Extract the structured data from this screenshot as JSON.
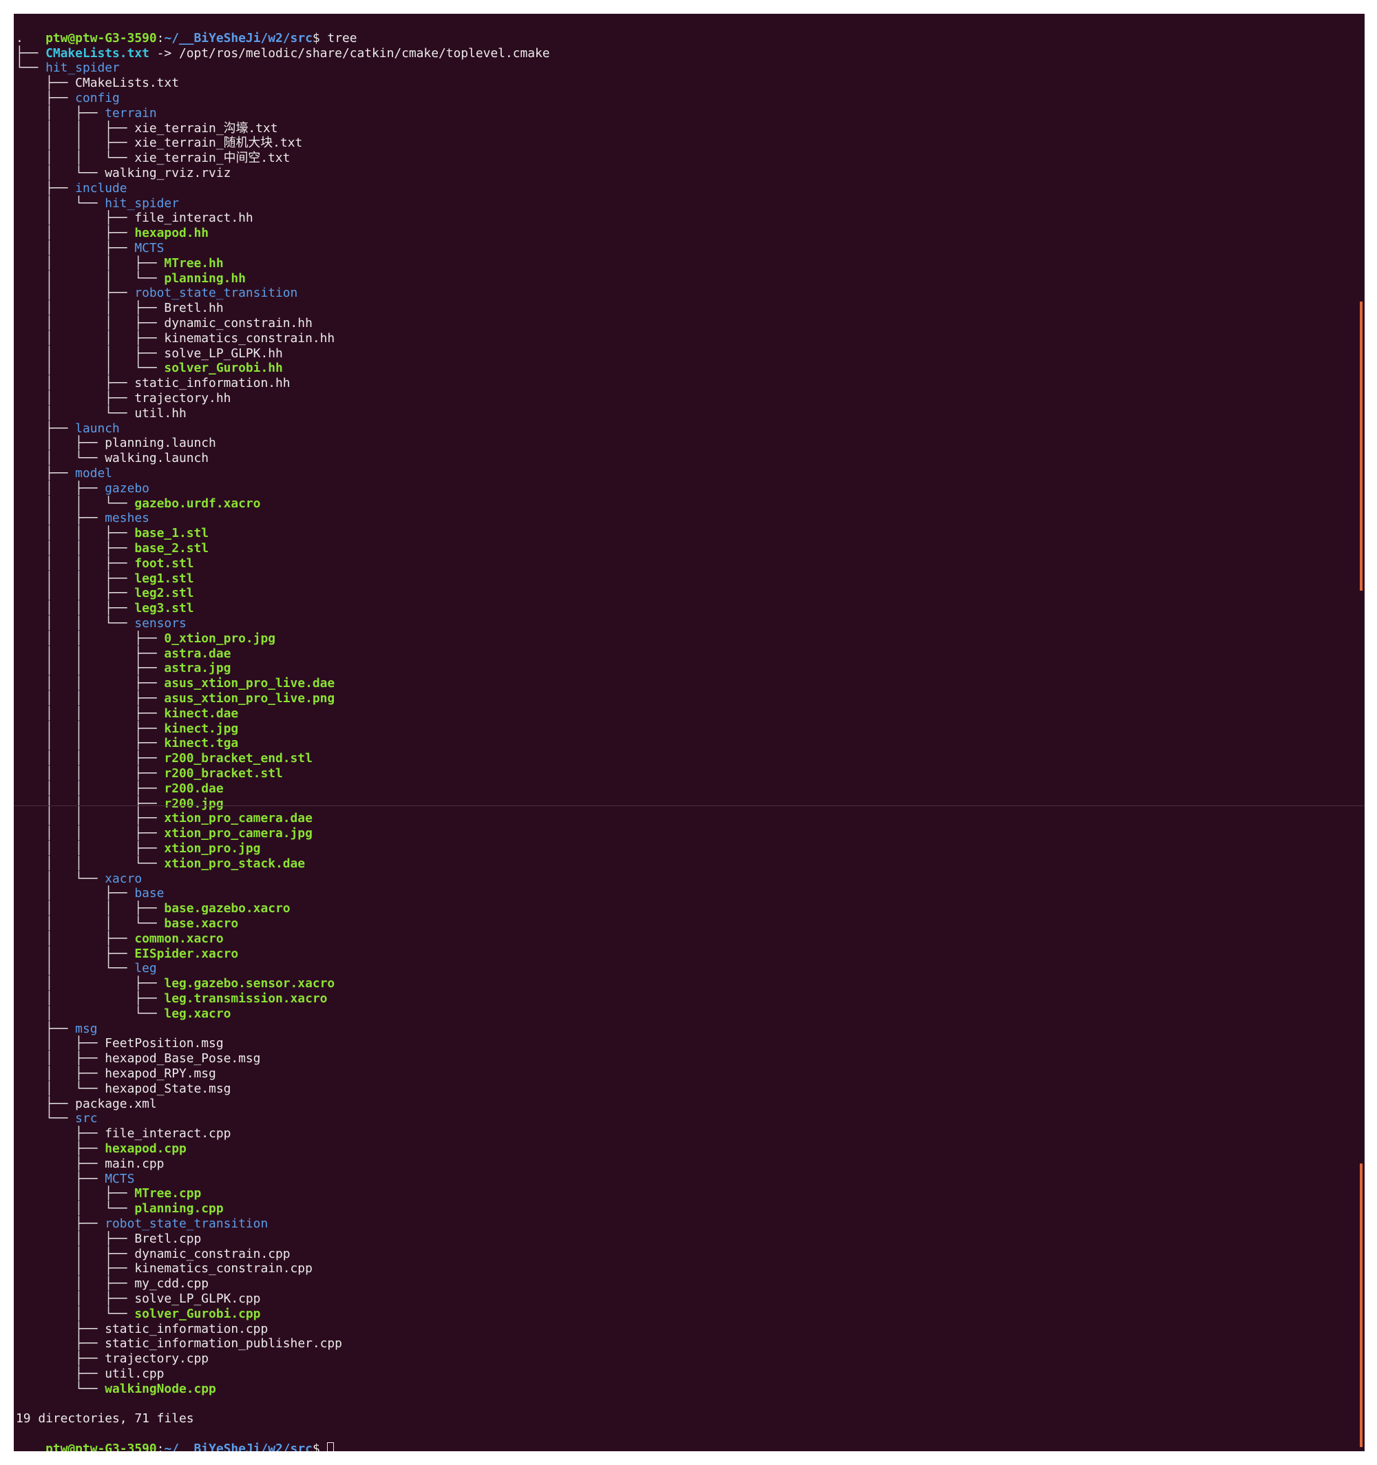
{
  "colors": {
    "terminal_background": "#2b0c1e",
    "text": "#ecebeb",
    "directory": "#5a9dea",
    "executable": "#8ae234",
    "symlink": "#38c6e0",
    "scroll_marker": "#e06a3c"
  },
  "prompt": {
    "user_host": "ptw@ptw-G3-3590",
    "separator": ":",
    "path": "~/__BiYeSheJi/w2/src",
    "symbol": "$ ",
    "command": "tree"
  },
  "tree": [
    {
      "prefix": "",
      "name": ".",
      "kind": "dir_plain"
    },
    {
      "prefix": "├── ",
      "name": "CMakeLists.txt",
      "kind": "link",
      "target": " -> /opt/ros/melodic/share/catkin/cmake/toplevel.cmake"
    },
    {
      "prefix": "└── ",
      "name": "hit_spider",
      "kind": "dir"
    },
    {
      "prefix": "    ├── ",
      "name": "CMakeLists.txt",
      "kind": "file"
    },
    {
      "prefix": "    ├── ",
      "name": "config",
      "kind": "dir"
    },
    {
      "prefix": "    │   ├── ",
      "name": "terrain",
      "kind": "dir"
    },
    {
      "prefix": "    │   │   ├── ",
      "name": "xie_terrain_沟壕.txt",
      "kind": "file"
    },
    {
      "prefix": "    │   │   ├── ",
      "name": "xie_terrain_随机大块.txt",
      "kind": "file"
    },
    {
      "prefix": "    │   │   └── ",
      "name": "xie_terrain_中间空.txt",
      "kind": "file"
    },
    {
      "prefix": "    │   └── ",
      "name": "walking_rviz.rviz",
      "kind": "file"
    },
    {
      "prefix": "    ├── ",
      "name": "include",
      "kind": "dir"
    },
    {
      "prefix": "    │   └── ",
      "name": "hit_spider",
      "kind": "dir"
    },
    {
      "prefix": "    │       ├── ",
      "name": "file_interact.hh",
      "kind": "file"
    },
    {
      "prefix": "    │       ├── ",
      "name": "hexapod.hh",
      "kind": "exec"
    },
    {
      "prefix": "    │       ├── ",
      "name": "MCTS",
      "kind": "dir"
    },
    {
      "prefix": "    │       │   ├── ",
      "name": "MTree.hh",
      "kind": "exec"
    },
    {
      "prefix": "    │       │   └── ",
      "name": "planning.hh",
      "kind": "exec"
    },
    {
      "prefix": "    │       ├── ",
      "name": "robot_state_transition",
      "kind": "dir"
    },
    {
      "prefix": "    │       │   ├── ",
      "name": "Bretl.hh",
      "kind": "file"
    },
    {
      "prefix": "    │       │   ├── ",
      "name": "dynamic_constrain.hh",
      "kind": "file"
    },
    {
      "prefix": "    │       │   ├── ",
      "name": "kinematics_constrain.hh",
      "kind": "file"
    },
    {
      "prefix": "    │       │   ├── ",
      "name": "solve_LP_GLPK.hh",
      "kind": "file"
    },
    {
      "prefix": "    │       │   └── ",
      "name": "solver_Gurobi.hh",
      "kind": "exec"
    },
    {
      "prefix": "    │       ├── ",
      "name": "static_information.hh",
      "kind": "file"
    },
    {
      "prefix": "    │       ├── ",
      "name": "trajectory.hh",
      "kind": "file"
    },
    {
      "prefix": "    │       └── ",
      "name": "util.hh",
      "kind": "file"
    },
    {
      "prefix": "    ├── ",
      "name": "launch",
      "kind": "dir"
    },
    {
      "prefix": "    │   ├── ",
      "name": "planning.launch",
      "kind": "file"
    },
    {
      "prefix": "    │   └── ",
      "name": "walking.launch",
      "kind": "file"
    },
    {
      "prefix": "    ├── ",
      "name": "model",
      "kind": "dir"
    },
    {
      "prefix": "    │   ├── ",
      "name": "gazebo",
      "kind": "dir"
    },
    {
      "prefix": "    │   │   └── ",
      "name": "gazebo.urdf.xacro",
      "kind": "exec"
    },
    {
      "prefix": "    │   ├── ",
      "name": "meshes",
      "kind": "dir"
    },
    {
      "prefix": "    │   │   ├── ",
      "name": "base_1.stl",
      "kind": "exec"
    },
    {
      "prefix": "    │   │   ├── ",
      "name": "base_2.stl",
      "kind": "exec"
    },
    {
      "prefix": "    │   │   ├── ",
      "name": "foot.stl",
      "kind": "exec"
    },
    {
      "prefix": "    │   │   ├── ",
      "name": "leg1.stl",
      "kind": "exec"
    },
    {
      "prefix": "    │   │   ├── ",
      "name": "leg2.stl",
      "kind": "exec"
    },
    {
      "prefix": "    │   │   ├── ",
      "name": "leg3.stl",
      "kind": "exec"
    },
    {
      "prefix": "    │   │   └── ",
      "name": "sensors",
      "kind": "dir"
    },
    {
      "prefix": "    │   │       ├── ",
      "name": "0_xtion_pro.jpg",
      "kind": "exec"
    },
    {
      "prefix": "    │   │       ├── ",
      "name": "astra.dae",
      "kind": "exec"
    },
    {
      "prefix": "    │   │       ├── ",
      "name": "astra.jpg",
      "kind": "exec"
    },
    {
      "prefix": "    │   │       ├── ",
      "name": "asus_xtion_pro_live.dae",
      "kind": "exec"
    },
    {
      "prefix": "    │   │       ├── ",
      "name": "asus_xtion_pro_live.png",
      "kind": "exec"
    },
    {
      "prefix": "    │   │       ├── ",
      "name": "kinect.dae",
      "kind": "exec"
    },
    {
      "prefix": "    │   │       ├── ",
      "name": "kinect.jpg",
      "kind": "exec"
    },
    {
      "prefix": "    │   │       ├── ",
      "name": "kinect.tga",
      "kind": "exec"
    },
    {
      "prefix": "    │   │       ├── ",
      "name": "r200_bracket_end.stl",
      "kind": "exec"
    },
    {
      "prefix": "    │   │       ├── ",
      "name": "r200_bracket.stl",
      "kind": "exec"
    },
    {
      "prefix": "    │   │       ├── ",
      "name": "r200.dae",
      "kind": "exec"
    },
    {
      "prefix": "    │   │       ├── ",
      "name": "r200.jpg",
      "kind": "exec"
    },
    {
      "prefix": "    │   │       ├── ",
      "name": "xtion_pro_camera.dae",
      "kind": "exec"
    },
    {
      "prefix": "    │   │       ├── ",
      "name": "xtion_pro_camera.jpg",
      "kind": "exec"
    },
    {
      "prefix": "    │   │       ├── ",
      "name": "xtion_pro.jpg",
      "kind": "exec"
    },
    {
      "prefix": "    │   │       └── ",
      "name": "xtion_pro_stack.dae",
      "kind": "exec"
    },
    {
      "prefix": "    │   └── ",
      "name": "xacro",
      "kind": "dir"
    },
    {
      "prefix": "    │       ├── ",
      "name": "base",
      "kind": "dir"
    },
    {
      "prefix": "    │       │   ├── ",
      "name": "base.gazebo.xacro",
      "kind": "exec"
    },
    {
      "prefix": "    │       │   └── ",
      "name": "base.xacro",
      "kind": "exec"
    },
    {
      "prefix": "    │       ├── ",
      "name": "common.xacro",
      "kind": "exec"
    },
    {
      "prefix": "    │       ├── ",
      "name": "EISpider.xacro",
      "kind": "exec"
    },
    {
      "prefix": "    │       └── ",
      "name": "leg",
      "kind": "dir"
    },
    {
      "prefix": "    │           ├── ",
      "name": "leg.gazebo.sensor.xacro",
      "kind": "exec"
    },
    {
      "prefix": "    │           ├── ",
      "name": "leg.transmission.xacro",
      "kind": "exec"
    },
    {
      "prefix": "    │           └── ",
      "name": "leg.xacro",
      "kind": "exec"
    },
    {
      "prefix": "    ├── ",
      "name": "msg",
      "kind": "dir"
    },
    {
      "prefix": "    │   ├── ",
      "name": "FeetPosition.msg",
      "kind": "file"
    },
    {
      "prefix": "    │   ├── ",
      "name": "hexapod_Base_Pose.msg",
      "kind": "file"
    },
    {
      "prefix": "    │   ├── ",
      "name": "hexapod_RPY.msg",
      "kind": "file"
    },
    {
      "prefix": "    │   └── ",
      "name": "hexapod_State.msg",
      "kind": "file"
    },
    {
      "prefix": "    ├── ",
      "name": "package.xml",
      "kind": "file"
    },
    {
      "prefix": "    └── ",
      "name": "src",
      "kind": "dir"
    },
    {
      "prefix": "        ├── ",
      "name": "file_interact.cpp",
      "kind": "file"
    },
    {
      "prefix": "        ├── ",
      "name": "hexapod.cpp",
      "kind": "exec"
    },
    {
      "prefix": "        ├── ",
      "name": "main.cpp",
      "kind": "file"
    },
    {
      "prefix": "        ├── ",
      "name": "MCTS",
      "kind": "dir"
    },
    {
      "prefix": "        │   ├── ",
      "name": "MTree.cpp",
      "kind": "exec"
    },
    {
      "prefix": "        │   └── ",
      "name": "planning.cpp",
      "kind": "exec"
    },
    {
      "prefix": "        ├── ",
      "name": "robot_state_transition",
      "kind": "dir"
    },
    {
      "prefix": "        │   ├── ",
      "name": "Bretl.cpp",
      "kind": "file"
    },
    {
      "prefix": "        │   ├── ",
      "name": "dynamic_constrain.cpp",
      "kind": "file"
    },
    {
      "prefix": "        │   ├── ",
      "name": "kinematics_constrain.cpp",
      "kind": "file"
    },
    {
      "prefix": "        │   ├── ",
      "name": "my_cdd.cpp",
      "kind": "file"
    },
    {
      "prefix": "        │   ├── ",
      "name": "solve_LP_GLPK.cpp",
      "kind": "file"
    },
    {
      "prefix": "        │   └── ",
      "name": "solver_Gurobi.cpp",
      "kind": "exec"
    },
    {
      "prefix": "        ├── ",
      "name": "static_information.cpp",
      "kind": "file"
    },
    {
      "prefix": "        ├── ",
      "name": "static_information_publisher.cpp",
      "kind": "file"
    },
    {
      "prefix": "        ├── ",
      "name": "trajectory.cpp",
      "kind": "file"
    },
    {
      "prefix": "        ├── ",
      "name": "util.cpp",
      "kind": "file"
    },
    {
      "prefix": "        └── ",
      "name": "walkingNode.cpp",
      "kind": "exec"
    }
  ],
  "summary": "19 directories, 71 files"
}
